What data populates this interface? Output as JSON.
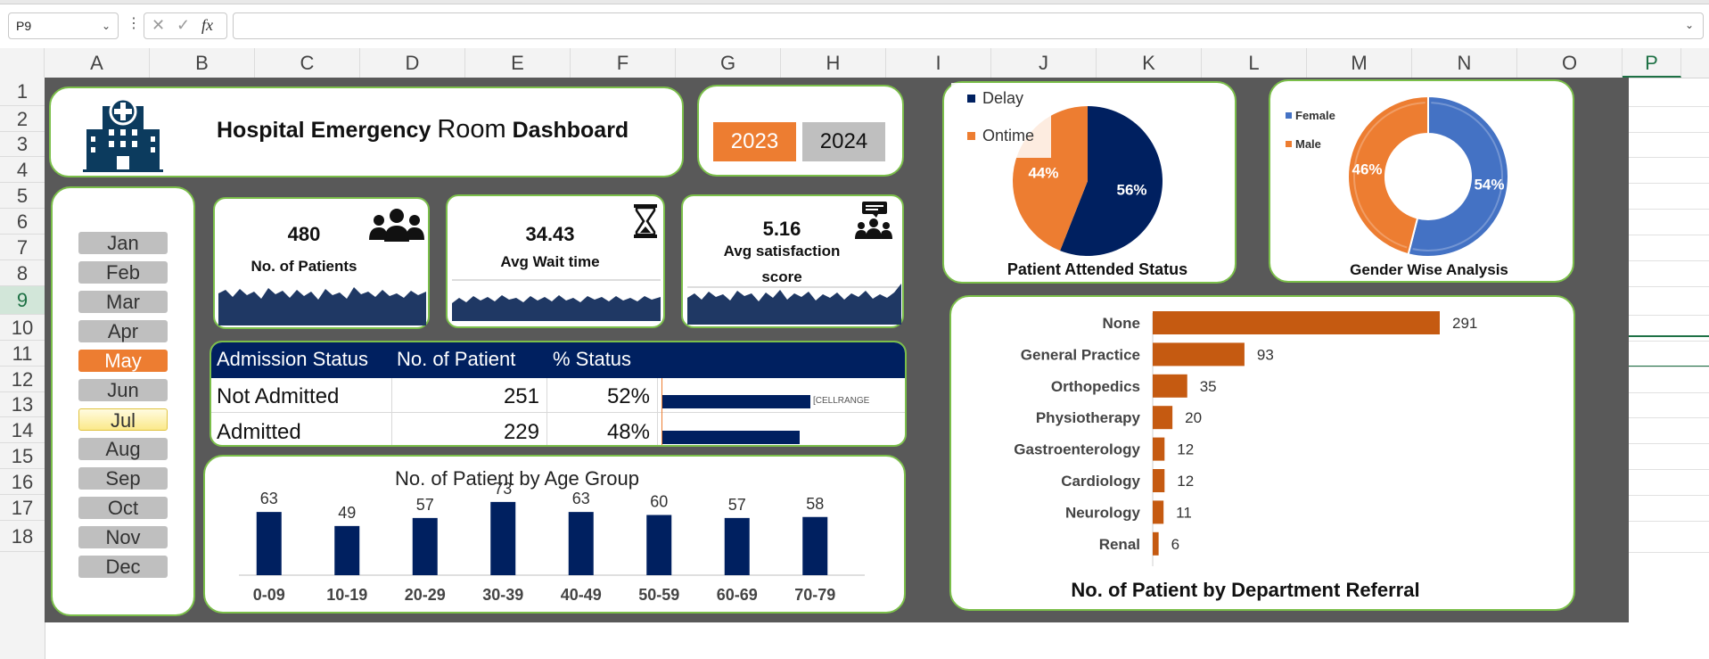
{
  "formula_bar": {
    "name_box": "P9",
    "fx_symbol": "fx",
    "formula": ""
  },
  "columns": [
    "A",
    "B",
    "C",
    "D",
    "E",
    "F",
    "G",
    "H",
    "I",
    "J",
    "K",
    "L",
    "M",
    "N",
    "O",
    "P"
  ],
  "rows": [
    "1",
    "2",
    "3",
    "4",
    "5",
    "6",
    "7",
    "8",
    "9",
    "10",
    "11",
    "12",
    "13",
    "14",
    "15",
    "16",
    "17",
    "18"
  ],
  "selected_cell": {
    "column": "P",
    "row": "9"
  },
  "dashboard": {
    "title_part1": "Hospital Emergency ",
    "title_part2": "Room",
    "title_part3": " Dashboard",
    "years": [
      "2023",
      "2024"
    ],
    "selected_year": "2023",
    "months": [
      "Jan",
      "Feb",
      "Mar",
      "Apr",
      "May",
      "Jun",
      "Jul",
      "Aug",
      "Sep",
      "Oct",
      "Nov",
      "Dec"
    ],
    "selected_month": "May",
    "hovered_month": "Jul",
    "kpis": [
      {
        "value": "480",
        "label": "No. of Patients",
        "icon": "people-group-icon"
      },
      {
        "value": "34.43",
        "label": "Avg Wait time",
        "icon": "hourglass-icon"
      },
      {
        "value": "5.16",
        "label_line1": "Avg satisfaction",
        "label_line2": "score",
        "icon": "people-chat-icon"
      }
    ],
    "admission_table": {
      "headers": [
        "Admission Status",
        "No. of Patient",
        "% Status"
      ],
      "rows": [
        {
          "status": "Not Admitted",
          "count": "251",
          "pct": "52%",
          "bar_fraction": 0.52
        },
        {
          "status": "Admitted",
          "count": "229",
          "pct": "48%",
          "bar_fraction": 0.48
        }
      ],
      "bar_label": "[CELLRANGE"
    },
    "colors": {
      "orange": "#ed7d31",
      "navy": "#002060",
      "gray_btn": "#bfbfbf",
      "green_border": "#7bbf4a",
      "blue": "#4472c4",
      "burnt": "#c55a11"
    }
  },
  "chart_data": [
    {
      "type": "bar",
      "title": "No. of Patient by Age Group",
      "categories": [
        "0-09",
        "10-19",
        "20-29",
        "30-39",
        "40-49",
        "50-59",
        "60-69",
        "70-79"
      ],
      "values": [
        63,
        49,
        57,
        73,
        63,
        60,
        57,
        58
      ],
      "xlabel": "",
      "ylabel": ""
    },
    {
      "type": "pie",
      "title": "Patient Attended Status",
      "labels": [
        "Delay",
        "Ontime"
      ],
      "values": [
        56,
        44
      ],
      "value_labels": [
        "56%",
        "44%"
      ],
      "colors": [
        "#002060",
        "#ed7d31"
      ],
      "legend": "top-left"
    },
    {
      "type": "pie",
      "title": "Gender Wise Analysis",
      "labels": [
        "Female",
        "Male"
      ],
      "values": [
        54,
        46
      ],
      "value_labels": [
        "54%",
        "46%"
      ],
      "colors": [
        "#4472c4",
        "#ed7d31"
      ],
      "legend": "top-left"
    },
    {
      "type": "bar",
      "orientation": "horizontal",
      "title": "No. of Patient by Department Referral",
      "categories": [
        "None",
        "General Practice",
        "Orthopedics",
        "Physiotherapy",
        "Gastroenterology",
        "Cardiology",
        "Neurology",
        "Renal"
      ],
      "values": [
        291,
        93,
        35,
        20,
        12,
        12,
        11,
        6
      ]
    }
  ]
}
